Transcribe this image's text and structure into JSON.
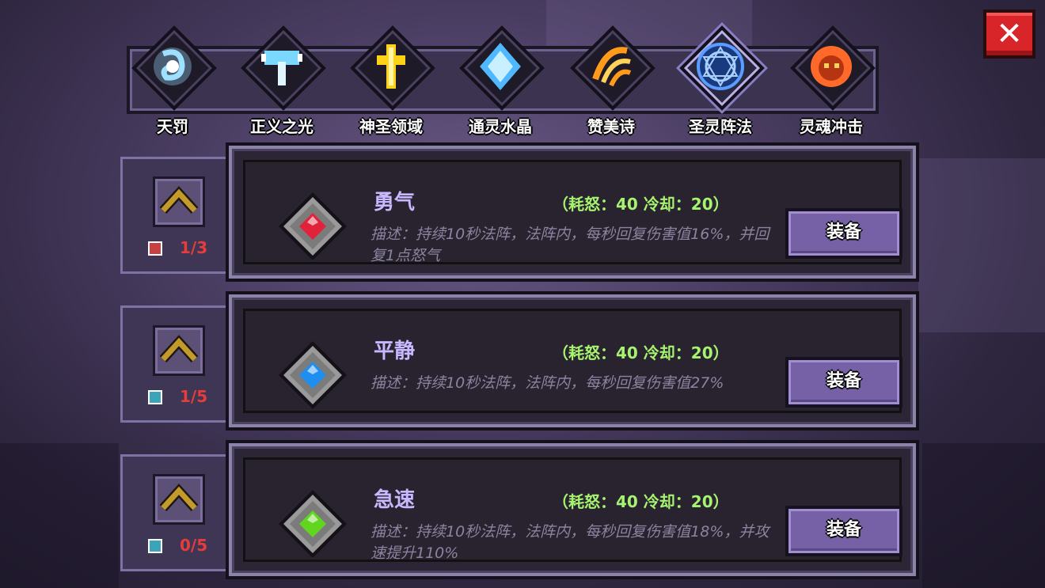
{
  "close_button": {
    "label": "✕"
  },
  "tabs": [
    {
      "label": "天罚",
      "icon": "lightning-swirl-icon",
      "color": "#9fe0ff",
      "selected": false
    },
    {
      "label": "正义之光",
      "icon": "holy-hammer-icon",
      "color": "#7ad8ff",
      "selected": false
    },
    {
      "label": "神圣领域",
      "icon": "golden-cross-icon",
      "color": "#ffd21a",
      "selected": false
    },
    {
      "label": "通灵水晶",
      "icon": "blue-crystal-icon",
      "color": "#4fb8ff",
      "selected": false
    },
    {
      "label": "赞美诗",
      "icon": "fire-claw-icon",
      "color": "#ff9a1a",
      "selected": false
    },
    {
      "label": "圣灵阵法",
      "icon": "magic-circle-icon",
      "color": "#5a9cff",
      "selected": true
    },
    {
      "label": "灵魂冲击",
      "icon": "fire-skull-icon",
      "color": "#ff6a2a",
      "selected": false
    }
  ],
  "skills": [
    {
      "name": "勇气",
      "cost": "（耗怒：40  冷却：20）",
      "description": "描述：持续10秒法阵，法阵内，每秒回复伤害值16%，并回复1点怒气",
      "equip_label": "装备",
      "gem_color": "#e0233a",
      "scroll_color": "red",
      "count": "1/3"
    },
    {
      "name": "平静",
      "cost": "（耗怒：40  冷却：20）",
      "description": "描述：持续10秒法阵，法阵内，每秒回复伤害值27%",
      "equip_label": "装备",
      "gem_color": "#1e8ff0",
      "scroll_color": "teal",
      "count": "1/5"
    },
    {
      "name": "急速",
      "cost": "（耗怒：40  冷却：20）",
      "description": "描述：持续10秒法阵，法阵内，每秒回复伤害值18%，并攻速提升110%",
      "equip_label": "装备",
      "gem_color": "#62d51e",
      "scroll_color": "teal",
      "count": "0/5"
    }
  ]
}
